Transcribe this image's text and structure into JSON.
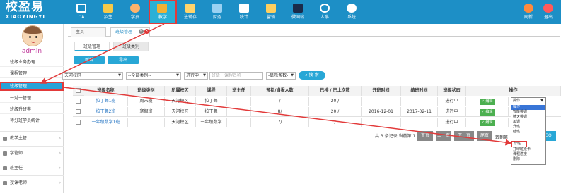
{
  "app": {
    "logo_cn": "校盈易",
    "logo_en": "XIAOYINGYI"
  },
  "nav": [
    {
      "label": "OA",
      "icon": "oa-icon",
      "color": "#ffffff"
    },
    {
      "label": "招生",
      "icon": "enroll-icon",
      "color": "#f7c948"
    },
    {
      "label": "学员",
      "icon": "student-icon",
      "color": "#ffb36b"
    },
    {
      "label": "教学",
      "icon": "teaching-icon",
      "color": "#f2b134"
    },
    {
      "label": "进销存",
      "icon": "inventory-icon",
      "color": "#ffd46b"
    },
    {
      "label": "财务",
      "icon": "finance-icon",
      "color": "#9ad1f2"
    },
    {
      "label": "统计",
      "icon": "stats-icon",
      "color": "#ffffff"
    },
    {
      "label": "营销",
      "icon": "marketing-icon",
      "color": "#ffcf5e"
    },
    {
      "label": "微网站",
      "icon": "microsite-icon",
      "color": "#1a2b4a"
    },
    {
      "label": "人事",
      "icon": "hr-icon",
      "color": "#ffffff"
    },
    {
      "label": "系统",
      "icon": "system-icon",
      "color": "#ffffff"
    }
  ],
  "nav_right": [
    {
      "label": "刷新",
      "icon": "refresh-icon",
      "color": "#ff8a3d"
    },
    {
      "label": "退出",
      "icon": "logout-icon",
      "color": "#ff5a5a"
    }
  ],
  "sidebar": {
    "user": "admin",
    "items": [
      "班级业务办理",
      "课程管理",
      "班级管理",
      "一对一管理",
      "班级升班率",
      "待分班学员统计"
    ],
    "groups": [
      "教学主管",
      "学管师",
      "班主任",
      "授课老师"
    ]
  },
  "tabs": {
    "home": "主页",
    "current": "班级管理"
  },
  "subtabs": [
    "班级管理",
    "班级类别"
  ],
  "toolbar": {
    "add": "新增",
    "export": "导出"
  },
  "filters": {
    "campus": "天河校区",
    "category": "--全部类别--",
    "status": "进行中",
    "search_placeholder": "班级，课程名称",
    "show": "-显示条数-",
    "search_btn": "搜 索"
  },
  "table": {
    "headers": [
      "班级名称",
      "班级类别",
      "所属校区",
      "课程",
      "班主任",
      "预招/当报人数",
      "已排 / 已上次数",
      "开班时间",
      "结班时间",
      "班级状态",
      "操作"
    ],
    "rows": [
      {
        "name": "拉丁舞1班",
        "category": "周末班",
        "campus": "天河校区",
        "course": "拉丁舞",
        "teacher": "",
        "enroll": "/",
        "sched": "20 /",
        "start": "",
        "end": "",
        "status": "进行中",
        "btn": "✓ 编辑"
      },
      {
        "name": "拉丁舞2班",
        "category": "寒假班",
        "campus": "天河校区",
        "course": "拉丁舞",
        "teacher": "",
        "enroll": "8/",
        "sched": "20 /",
        "start": "2016-12-01",
        "end": "2017-02-11",
        "status": "进行中",
        "btn": "✓ 编辑"
      },
      {
        "name": "一年级数学1班",
        "category": "",
        "campus": "天河校区",
        "course": "一年级数学",
        "teacher": "",
        "enroll": "7/",
        "sched": "/",
        "start": "",
        "end": "",
        "status": "进行中",
        "btn": "✓ 编辑"
      }
    ],
    "action_select": "操作"
  },
  "dropdown": {
    "selected": "操作",
    "options": [
      "操作",
      "智能排课",
      "插天排课",
      "加课",
      "升班",
      "结班",
      "分班",
      "打印班级卡",
      "课程进度",
      "删除"
    ],
    "highlighted": "操作",
    "marked": "分班"
  },
  "pager": {
    "summary": "共 3 条记录 当前第 1 / 1 页",
    "first": "首页",
    "prev": "上一页",
    "next": "下一页",
    "last": "尾页",
    "jump": "转到第",
    "go": "GO"
  },
  "colors": {
    "topbar": "#1d8fc6",
    "accent": "#28a7d6",
    "highlight": "#e23a3a",
    "edit": "#4caf50"
  }
}
